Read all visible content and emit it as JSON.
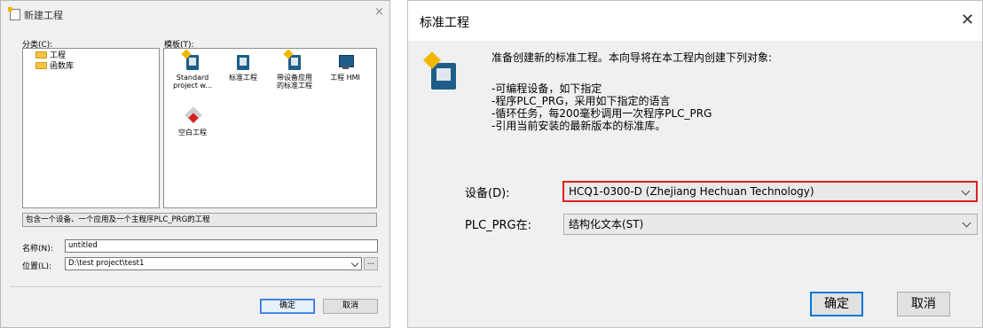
{
  "new_project_dialog": {
    "title": "新建工程",
    "close": "×",
    "categories_label": "分类(C):",
    "templates_label": "模板(T):",
    "categories": [
      {
        "label": "工程"
      },
      {
        "label": "函数库"
      }
    ],
    "templates": [
      {
        "label": "Standard project w...",
        "icon": "standard-project-icon"
      },
      {
        "label": "标准工程",
        "icon": "standard-project-icon"
      },
      {
        "label": "带设备应用的标准工程",
        "icon": "standard-project-icon"
      },
      {
        "label": "工程 HMI",
        "icon": "hmi-icon"
      },
      {
        "label": "空白工程",
        "icon": "empty-project-icon"
      }
    ],
    "description": "包含一个设备、一个应用及一个主程序PLC_PRG的工程",
    "name_label": "名称(N):",
    "name_value": "untitled",
    "location_label": "位置(L):",
    "location_value": "D:\\test project\\test1",
    "browse": "...",
    "ok": "确定",
    "cancel": "取消"
  },
  "standard_project_dialog": {
    "title": "标准工程",
    "close": "✕",
    "intro": "准备创建新的标准工程。本向导将在本工程内创建下列对象:",
    "bullets": [
      "-可编程设备，如下指定",
      "-程序PLC_PRG，采用如下指定的语言",
      "-循环任务，每200毫秒调用一次程序PLC_PRG",
      "-引用当前安装的最新版本的标准库。"
    ],
    "device_label": "设备(D):",
    "device_value": "HCQ1-0300-D (Zhejiang Hechuan Technology)",
    "plc_label": "PLC_PRG在:",
    "plc_value": "结构化文本(ST)",
    "ok": "确定",
    "cancel": "取消",
    "highlight_color": "#e0201f"
  }
}
